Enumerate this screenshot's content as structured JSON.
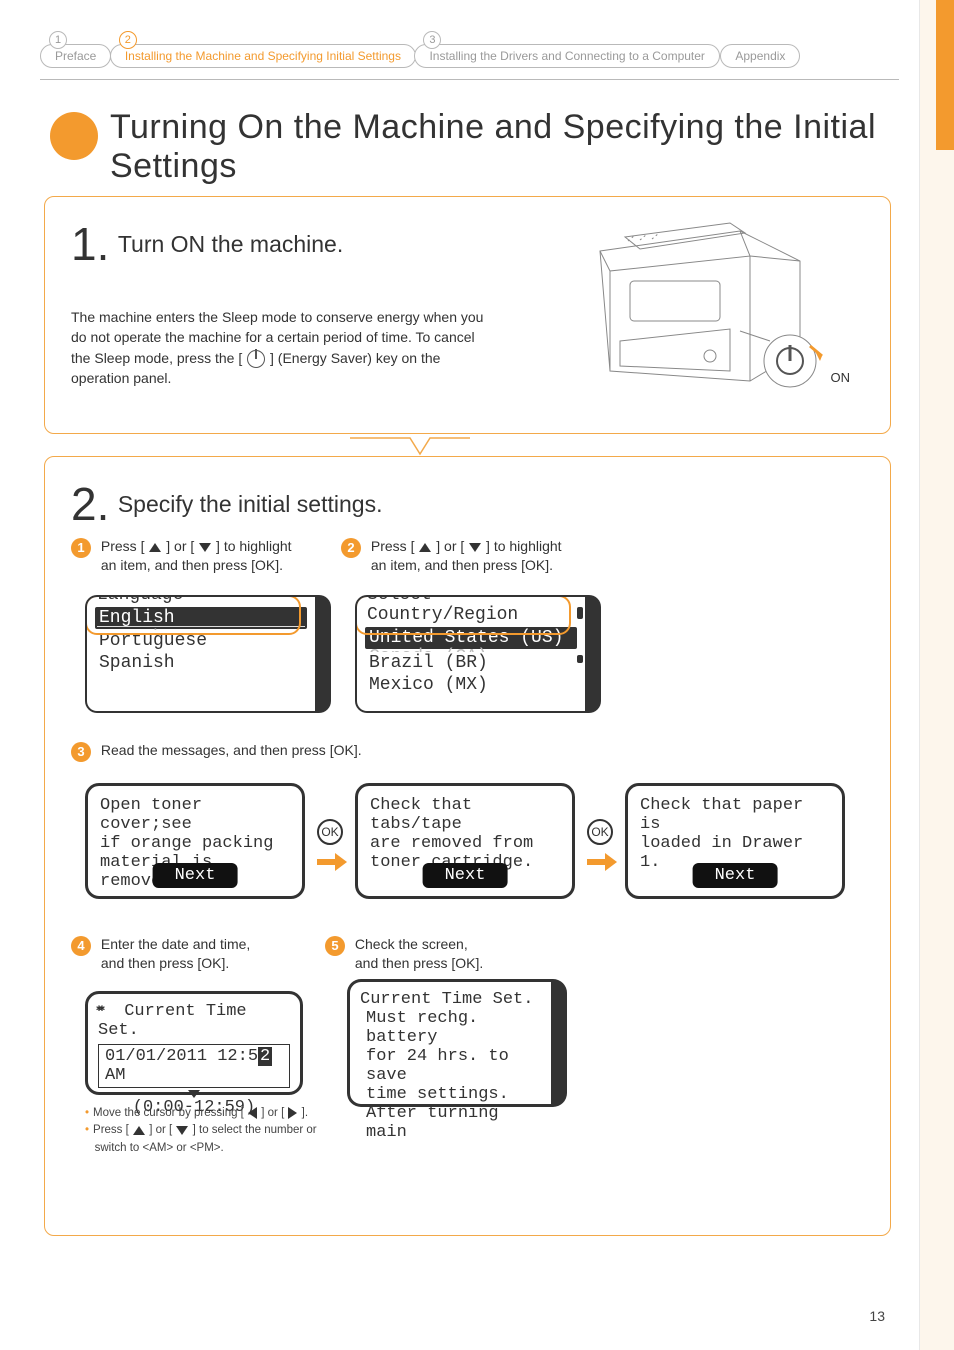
{
  "tabs": {
    "preface": "Preface",
    "install": "Installing the Machine and Specifying Initial Settings",
    "drivers": "Installing the Drivers and Connecting to a Computer",
    "appendix": "Appendix"
  },
  "title": "Turning On the Machine and Specifying the Initial Settings",
  "step1": {
    "head": "Turn ON the machine.",
    "body_a": "The machine enters the Sleep mode to conserve energy when you do not operate the machine for a certain period of time. To cancel the Sleep mode, press the [",
    "body_b": "] (Energy Saver) key on the operation panel.",
    "on_label": "ON"
  },
  "step2": {
    "head": "Specify the initial settings.",
    "sub1": "Press [ ▲ ] or [ ▼ ] to highlight an item, and then press [OK].",
    "sub2": "Press [ ▲ ] or [ ▼ ] to highlight an item, and then press [OK].",
    "sub3": "Read the messages, and then press [OK].",
    "sub4a": "Enter the date and time,",
    "sub4b": "and then press [OK].",
    "sub5a": "Check the screen,",
    "sub5b": "and then press [OK].",
    "lcd_lang": {
      "title": "Language",
      "sel": "English",
      "opt2": "Portuguese",
      "opt3": "Spanish"
    },
    "lcd_region": {
      "title": "Select Country/Region",
      "sel": "United States (US)",
      "fade": "Canada (CA)",
      "opt2": "Brazil (BR)",
      "opt3": "Mexico (MX)"
    },
    "msg1": {
      "l1": "Open toner cover;see",
      "l2": "if orange packing",
      "l3": "material is removed.",
      "next": "Next"
    },
    "msg2": {
      "l1": "Check that tabs/tape",
      "l2": "are removed from",
      "l3": "toner cartridge.",
      "next": "Next"
    },
    "msg3": {
      "l1": "Check that paper is",
      "l2": "loaded in Drawer 1.",
      "next": "Next"
    },
    "ok": "OK",
    "time1": {
      "title": "Current Time Set.",
      "value_a": "01/01/2011 12:5",
      "value_cur": "2",
      "value_b": " AM",
      "range": "(0:00-12:59)"
    },
    "time2": {
      "title": "Current Time Set.",
      "l1": "Must rechg. battery",
      "l2": "for 24 hrs. to save",
      "l3": "time settings.",
      "l4": "After turning main"
    },
    "note1": "Move the cursor by pressing [ ◀ ] or [ ▶ ].",
    "note2": "Press [ ▲ ] or [ ▼ ] to select the number or switch to <AM> or <PM>."
  },
  "page_number": "13"
}
